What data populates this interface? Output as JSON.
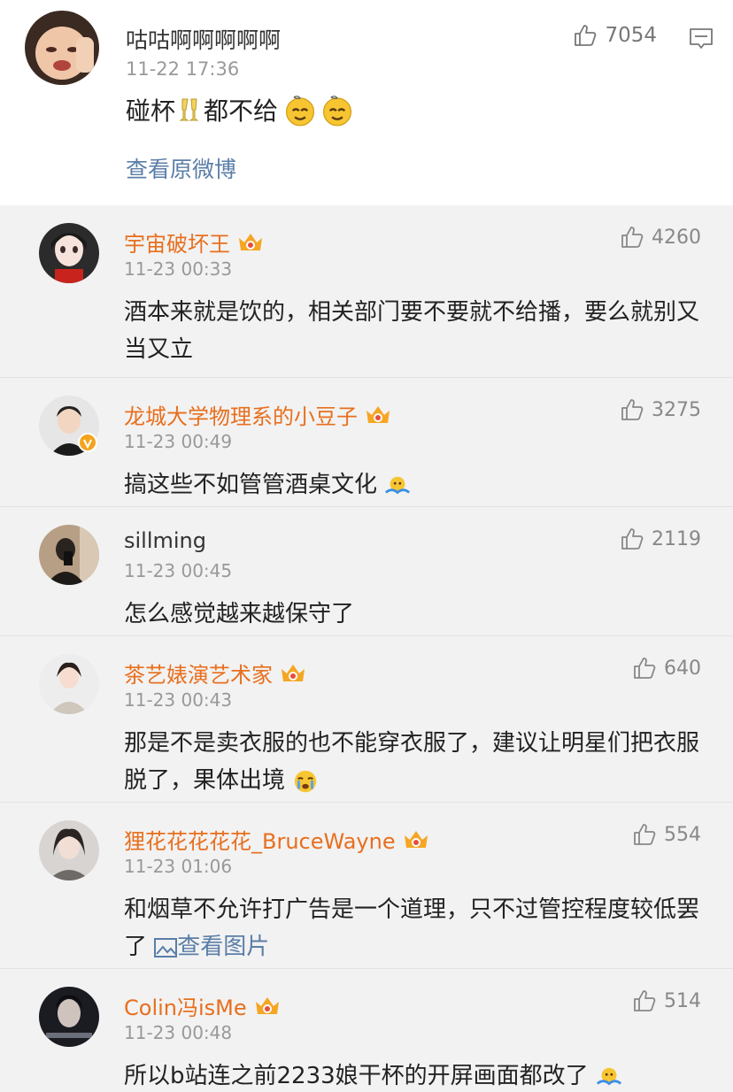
{
  "main_post": {
    "username": "咕咕啊啊啊啊啊",
    "timestamp": "11-22 17:36",
    "content_before": "碰杯",
    "content_after": "都不给",
    "likes": "7054",
    "view_original": "查看原微博"
  },
  "comments": [
    {
      "name": "宇宙破坏王",
      "time": "11-23 00:33",
      "likes": "4260",
      "text": "酒本来就是饮的，相关部门要不要就不给播，要么就别又当又立"
    },
    {
      "name": "龙城大学物理系的小豆子",
      "time": "11-23 00:49",
      "likes": "3275",
      "text": "搞这些不如管管酒桌文化"
    },
    {
      "name": "sillming",
      "time": "11-23 00:45",
      "likes": "2119",
      "text": "怎么感觉越来越保守了"
    },
    {
      "name": "茶艺婊演艺术家",
      "time": "11-23 00:43",
      "likes": "640",
      "text": "那是不是卖衣服的也不能穿衣服了，建议让明星们把衣服脱了，果体出境"
    },
    {
      "name": "狸花花花花花_BruceWayne",
      "time": "11-23 01:06",
      "likes": "554",
      "text": "和烟草不允许打广告是一个道理，只不过管控程度较低罢了",
      "link": "查看图片"
    },
    {
      "name": "Colin冯isMe",
      "time": "11-23 00:48",
      "likes": "514",
      "text": "所以b站连之前2233娘干杯的开屏画面都改了"
    }
  ],
  "colors": {
    "accent_orange": "#e86f1d",
    "link_blue": "#5b7ea8",
    "muted": "#999999"
  }
}
